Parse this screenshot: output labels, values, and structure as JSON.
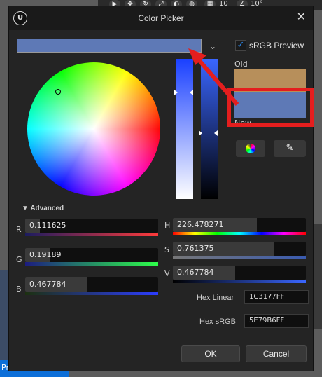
{
  "background": {
    "toolbar_numbers": [
      "10",
      "10°"
    ],
    "tab_label": "Pro"
  },
  "dialog": {
    "title": "Color Picker",
    "close_label": "✕",
    "logo_text": "U"
  },
  "current_color_hex": "#5E79B6",
  "old_color_hex": "#B78F5B",
  "srgb_preview": {
    "label": "sRGB Preview",
    "checked": true,
    "check_glyph": "✓"
  },
  "swatches": {
    "old_label": "Old",
    "new_label": "New"
  },
  "tools": {
    "color_wheel_icon": "color-wheel-icon",
    "eyedropper_icon": "eyedropper-icon"
  },
  "advanced": {
    "toggle_glyph": "▼",
    "label": "Advanced",
    "rgb": [
      {
        "name": "R",
        "value": "0.111625",
        "fraction": 0.111625
      },
      {
        "name": "G",
        "value": "0.19189",
        "fraction": 0.19189
      },
      {
        "name": "B",
        "value": "0.467784",
        "fraction": 0.467784
      }
    ],
    "hsv": [
      {
        "name": "H",
        "value": "226.478271",
        "fraction": 0.6291
      },
      {
        "name": "S",
        "value": "0.761375",
        "fraction": 0.761375
      },
      {
        "name": "V",
        "value": "0.467784",
        "fraction": 0.467784
      }
    ]
  },
  "hex": {
    "linear_label": "Hex Linear",
    "linear_value": "1C3177FF",
    "srgb_label": "Hex sRGB",
    "srgb_value": "5E79B6FF"
  },
  "buttons": {
    "ok": "OK",
    "cancel": "Cancel"
  },
  "annotation": {
    "highlight_color": "#E41E1E"
  }
}
